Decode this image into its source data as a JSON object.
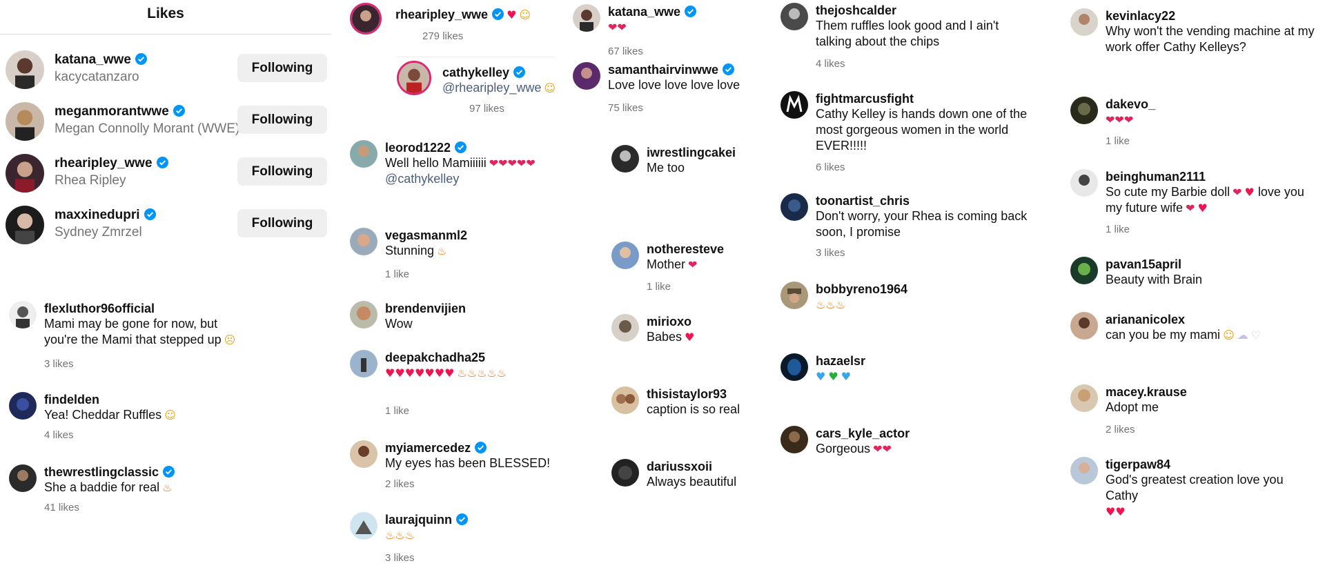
{
  "likes_panel": {
    "title": "Likes",
    "follow_label": "Following",
    "users": [
      {
        "username": "katana_wwe",
        "fullname": "kacycatanzaro",
        "verified": true
      },
      {
        "username": "meganmorantwwe",
        "fullname": "Megan Connolly Morant (WWE)",
        "verified": true
      },
      {
        "username": "rhearipley_wwe",
        "fullname": "Rhea Ripley",
        "verified": true
      },
      {
        "username": "maxxinedupri",
        "fullname": "Sydney Zmrzel",
        "verified": true
      }
    ]
  },
  "comments": {
    "c1": {
      "username": "flexluthor96official",
      "text1": "Mami may be gone for now, but",
      "text2": "you're the Mami that stepped up",
      "likes": "3 likes"
    },
    "c2": {
      "username": "findelden",
      "text": "Yea! Cheddar Ruffles",
      "likes": "4 likes"
    },
    "c3": {
      "username": "thewrestlingclassic",
      "text": "She a baddie for real",
      "likes": "41 likes",
      "verified": true
    },
    "c4": {
      "username": "rhearipley_wwe",
      "likes": "279 likes",
      "verified": true
    },
    "c5": {
      "username": "cathykelley",
      "text": "@rhearipley_wwe",
      "likes": "97 likes",
      "verified": true
    },
    "c6": {
      "username": "leorod1222",
      "text1": "Well hello Mamiiiiii",
      "text2": "@cathykelley",
      "verified": true
    },
    "c7": {
      "username": "vegasmanml2",
      "text": "Stunning",
      "likes": "1 like"
    },
    "c8": {
      "username": "brendenvijien",
      "text": "Wow"
    },
    "c9": {
      "username": "deepakchadha25",
      "likes": "1 like"
    },
    "c10": {
      "username": "myiamercedez",
      "text": "My eyes has been BLESSED!",
      "likes": "2 likes",
      "verified": true
    },
    "c11": {
      "username": "laurajquinn",
      "likes": "3 likes",
      "verified": true
    },
    "c12": {
      "username": "katana_wwe",
      "likes": "67 likes",
      "verified": true
    },
    "c13": {
      "username": "samanthairvinwwe",
      "text": "Love love love love love",
      "likes": "75 likes",
      "verified": true
    },
    "c14": {
      "username": "iwrestlingcakei",
      "text": "Me too"
    },
    "c15": {
      "username": "notheresteve",
      "text": "Mother",
      "likes": "1 like"
    },
    "c16": {
      "username": "mirioxo",
      "text": "Babes"
    },
    "c17": {
      "username": "thisistaylor93",
      "text": "caption is so real"
    },
    "c18": {
      "username": "dariussxoii",
      "text": "Always beautiful"
    },
    "c19": {
      "username": "thejoshcalder",
      "text1": "Them ruffles look good and I ain't",
      "text2": "talking about the chips",
      "likes": "4 likes"
    },
    "c20": {
      "username": "fightmarcusfight",
      "text1": "Cathy Kelley is hands down one of the",
      "text2": "most gorgeous women in the world",
      "text3": "EVER!!!!!",
      "likes": "6 likes"
    },
    "c21": {
      "username": "toonartist_chris",
      "text1": "Don't worry, your Rhea is coming back",
      "text2": "soon, I promise",
      "likes": "3 likes"
    },
    "c22": {
      "username": "bobbyreno1964"
    },
    "c23": {
      "username": "hazaelsr"
    },
    "c24": {
      "username": "cars_kyle_actor",
      "text": "Gorgeous"
    },
    "c25": {
      "username": "kevinlacy22",
      "text1": "Why won't the vending machine at my",
      "text2": "work offer Cathy Kelleys?"
    },
    "c26": {
      "username": "dakevo_",
      "likes": "1 like"
    },
    "c27": {
      "username": "beinghuman2111",
      "text1": "So cute my Barbie doll",
      "text1b": "love you",
      "text2": "my future wife",
      "likes": "1 like"
    },
    "c28": {
      "username": "pavan15april",
      "text": "Beauty with Brain"
    },
    "c29": {
      "username": "ariananicolex",
      "text": "can you be my mami"
    },
    "c30": {
      "username": "macey.krause",
      "text": "Adopt me",
      "likes": "2 likes"
    },
    "c31": {
      "username": "tigerpaw84",
      "text": "God's greatest creation love you Cathy"
    }
  },
  "icons": {
    "verified": "verified-badge-icon",
    "heart_eyes": "heart-eyes-emoji",
    "red_heart": "red-heart-emoji",
    "fire": "fire-emoji",
    "blue_heart": "blue-heart-emoji",
    "green_heart": "green-heart-emoji"
  },
  "colors": {
    "verified": "#0095f6",
    "secondary_text": "#737373",
    "button_bg": "#efefef"
  }
}
